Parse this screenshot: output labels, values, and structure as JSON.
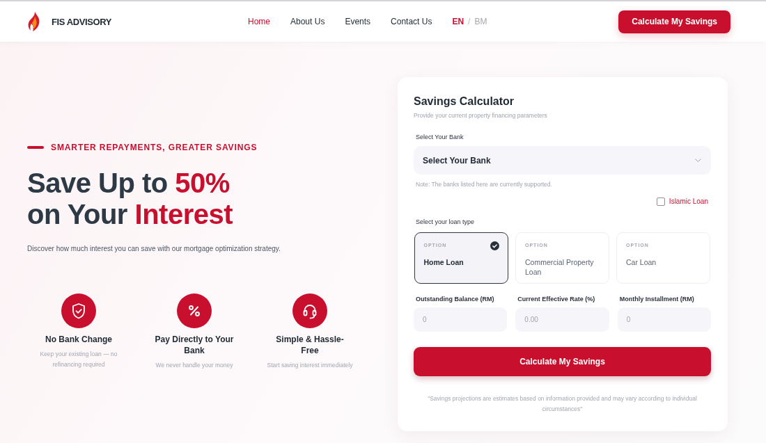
{
  "header": {
    "logo_text": "FIS ADVISORY",
    "nav": [
      {
        "label": "Home",
        "selected": true
      },
      {
        "label": "About Us",
        "selected": false
      },
      {
        "label": "Events",
        "selected": false
      },
      {
        "label": "Contact Us",
        "selected": false
      }
    ],
    "languages": [
      {
        "label": "EN",
        "selected": true
      },
      {
        "label": "BM",
        "selected": false
      }
    ],
    "language_separator": "/",
    "cta": "Calculate My Savings"
  },
  "hero": {
    "tagline": "SMARTER REPAYMENTS, GREATER SAVINGS",
    "heading": [
      [
        {
          "text": "Save Up to ",
          "accent": false
        },
        {
          "text": "50%",
          "accent": true
        }
      ],
      [
        {
          "text": "on Your ",
          "accent": false
        },
        {
          "text": "Interest",
          "accent": true
        }
      ]
    ],
    "description": "Discover how much interest you can save with our mortgage optimization strategy.",
    "features": [
      {
        "title": "No Bank Change",
        "description": "Keep your existing loan — no refinancing required"
      },
      {
        "title": "Pay Directly to Your Bank",
        "description": "We never handle your money"
      },
      {
        "title": "Simple & Hassle-Free",
        "description": "Start saving interest immediately"
      }
    ]
  },
  "calculator": {
    "title": "Savings Calculator",
    "subtitle": "Provide your current property financing parameters",
    "bank_label": "Select Your Bank",
    "bank_select": {
      "value": "Select Your Bank"
    },
    "note": "Note: The banks listed here are currently supported.",
    "islamic_loan": {
      "label": "Islamic Loan",
      "checked": false
    },
    "loan_type_label": "Select your loan type",
    "loan_types": [
      {
        "tag": "OPTION",
        "label": "Home Loan",
        "selected": true
      },
      {
        "tag": "OPTION",
        "label": "Commercial Property Loan",
        "selected": false
      },
      {
        "tag": "OPTION",
        "label": "Car Loan",
        "selected": false
      }
    ],
    "fields": [
      {
        "label": "Outstanding Balance (RM)",
        "placeholder": "0"
      },
      {
        "label": "Current Effective Rate (%)",
        "placeholder": "0.00"
      },
      {
        "label": "Monthly Installment (RM)",
        "placeholder": "0"
      }
    ],
    "submit": "Calculate My Savings",
    "disclaimer": "\"Savings projections are estimates based on information provided and may vary according to individual circumstances\""
  }
}
